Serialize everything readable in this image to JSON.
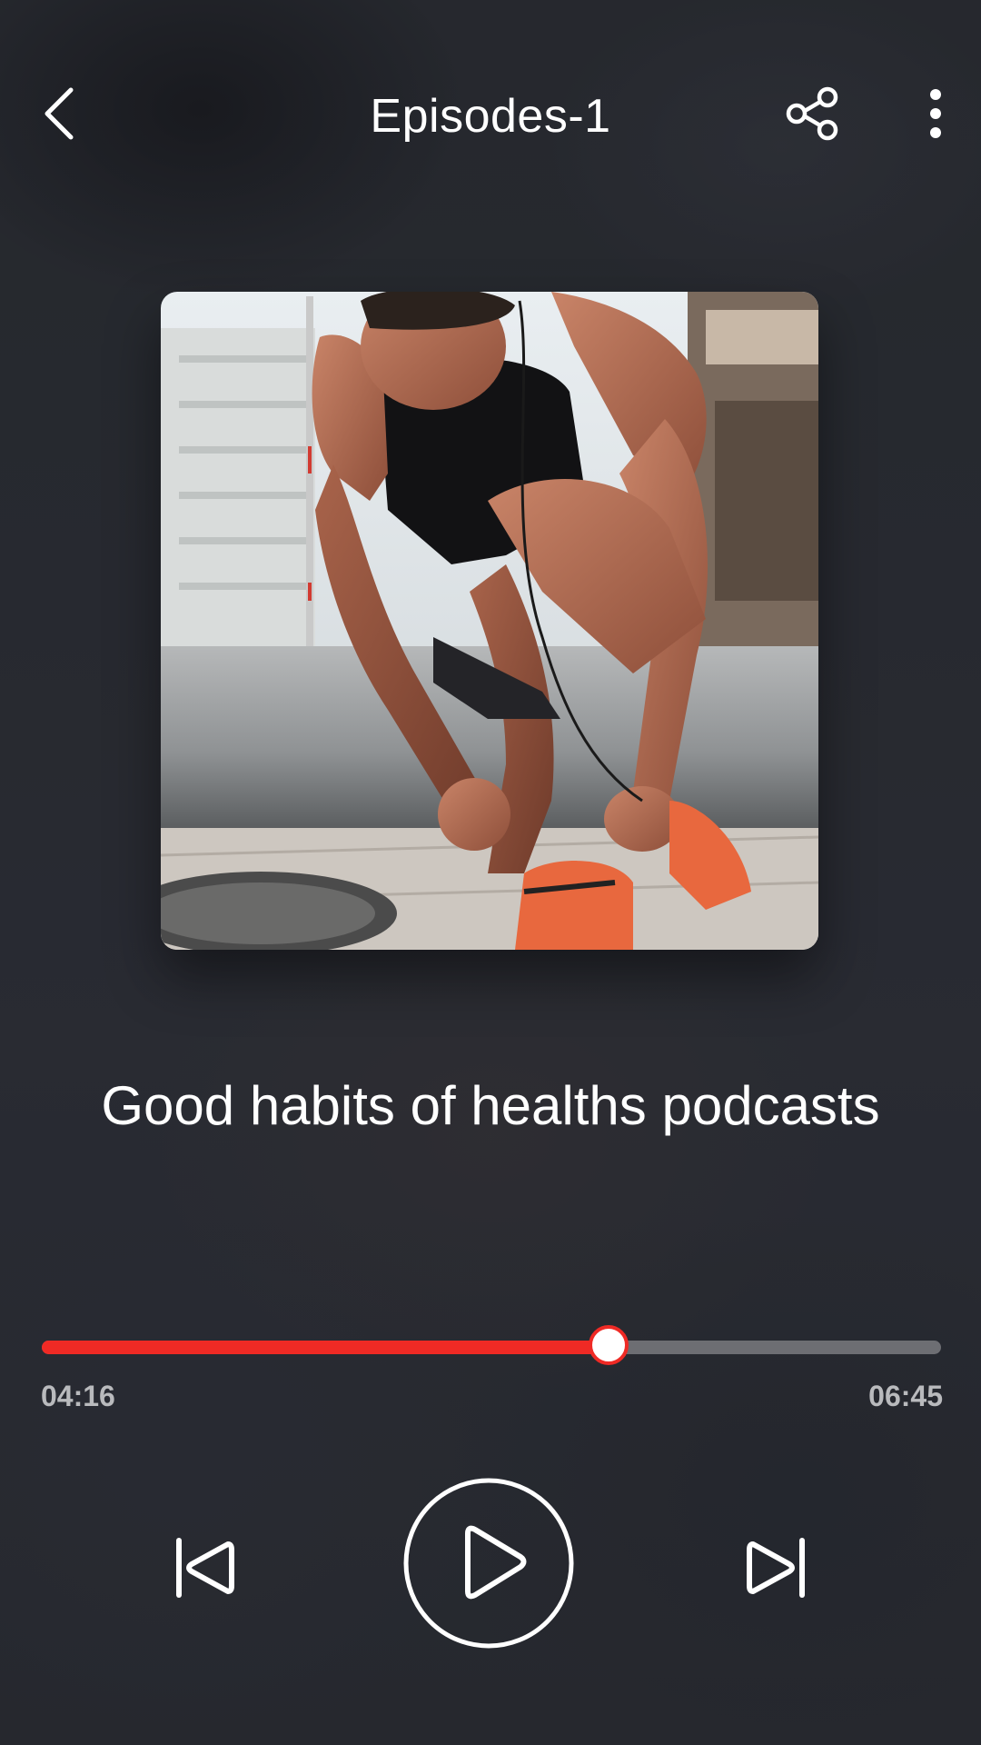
{
  "header": {
    "title": "Episodes-1",
    "back_icon": "chevron-left-icon",
    "share_icon": "share-icon",
    "more_icon": "more-vertical-icon"
  },
  "episode": {
    "title": "Good habits of healths podcasts",
    "artwork": "athlete-tying-shoelaces-photo"
  },
  "player": {
    "current_time": "04:16",
    "total_time": "06:45",
    "progress_fraction": 0.63,
    "prev_icon": "skip-previous-icon",
    "play_icon": "play-icon",
    "next_icon": "skip-next-icon"
  },
  "colors": {
    "accent": "#ef2a25",
    "track": "#6d6e73",
    "background": "#2b2d33",
    "time_text": "#b9babd"
  }
}
